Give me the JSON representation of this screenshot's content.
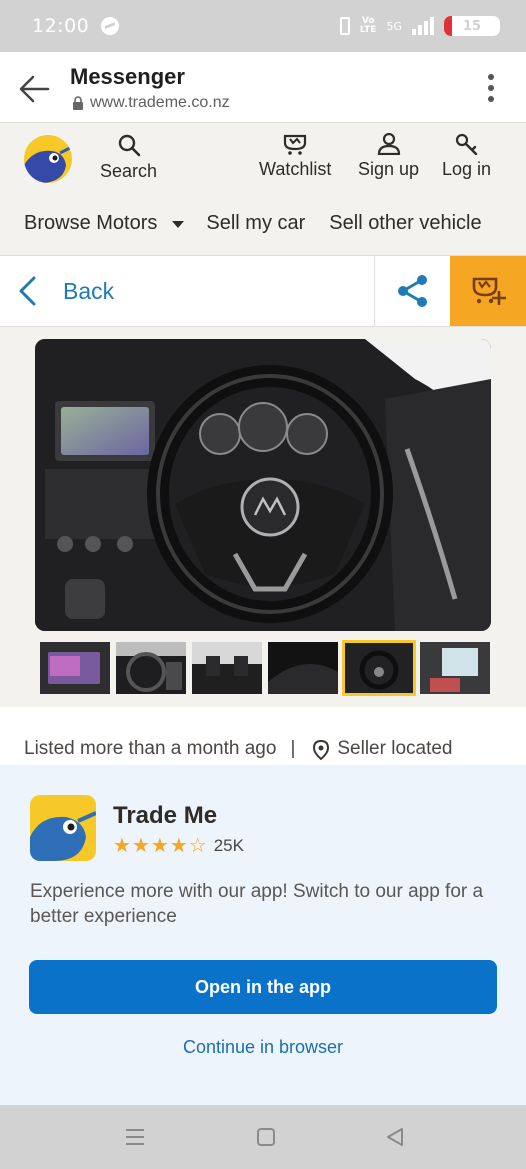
{
  "status_bar": {
    "time": "12:00",
    "network": "Vo LTE",
    "signal": "5G",
    "battery": "15"
  },
  "browser": {
    "title": "Messenger",
    "url": "www.trademe.co.nz"
  },
  "site_nav": {
    "search": "Search",
    "watchlist": "Watchlist",
    "sign_up": "Sign up",
    "log_in": "Log in"
  },
  "motors_nav": {
    "browse": "Browse Motors",
    "sell_car": "Sell my car",
    "sell_other": "Sell other vehicle"
  },
  "listing_bar": {
    "back": "Back"
  },
  "gallery": {
    "thumbnail_count": 6,
    "active_index": 4
  },
  "listing": {
    "listed": "Listed more than a month ago",
    "separator": "|",
    "seller": "Seller located"
  },
  "app_banner": {
    "name": "Trade Me",
    "rating_stars": 4,
    "rating_count": "25K",
    "description": "Experience more with our app! Switch to our app for a better experience",
    "open_button": "Open in the app",
    "continue_link": "Continue in browser"
  },
  "colors": {
    "brand_yellow": "#f6c929",
    "accent_blue": "#0a72c9",
    "link_blue": "#1f7ab8",
    "watch_orange": "#f5a623"
  }
}
